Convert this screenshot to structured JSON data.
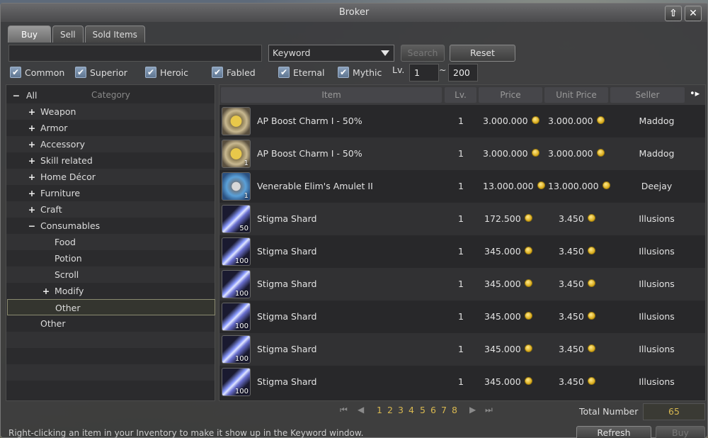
{
  "window": {
    "title": "Broker"
  },
  "title_buttons": {
    "restore": "⇧",
    "close": "✕"
  },
  "tabs": [
    {
      "label": "Buy"
    },
    {
      "label": "Sell"
    },
    {
      "label": "Sold Items"
    }
  ],
  "search": {
    "value": "",
    "mode": "Keyword",
    "search_label": "Search",
    "reset_label": "Reset"
  },
  "filters": [
    {
      "label": "Common",
      "checked": true
    },
    {
      "label": "Superior",
      "checked": true
    },
    {
      "label": "Heroic",
      "checked": true
    },
    {
      "label": "Fabled",
      "checked": true
    },
    {
      "label": "Eternal",
      "checked": true
    },
    {
      "label": "Mythic",
      "checked": true
    }
  ],
  "level": {
    "label": "Lv.",
    "min": "1",
    "sep": "~",
    "max": "200"
  },
  "category": {
    "header": "Category",
    "items": [
      {
        "toggle": "−",
        "label": "All"
      },
      {
        "toggle": "+",
        "label": "Weapon"
      },
      {
        "toggle": "+",
        "label": "Armor"
      },
      {
        "toggle": "+",
        "label": "Accessory"
      },
      {
        "toggle": "+",
        "label": "Skill related"
      },
      {
        "toggle": "+",
        "label": "Home Décor"
      },
      {
        "toggle": "+",
        "label": "Furniture"
      },
      {
        "toggle": "+",
        "label": "Craft"
      },
      {
        "toggle": "−",
        "label": "Consumables"
      },
      {
        "toggle": "",
        "label": "Food"
      },
      {
        "toggle": "",
        "label": "Potion"
      },
      {
        "toggle": "",
        "label": "Scroll"
      },
      {
        "toggle": "+",
        "label": "Modify"
      },
      {
        "toggle": "",
        "label": "Other"
      },
      {
        "toggle": "",
        "label": "Other"
      }
    ]
  },
  "columns": {
    "item": "Item",
    "lv": "Lv.",
    "price": "Price",
    "unit_price": "Unit Price",
    "seller": "Seller"
  },
  "rows": [
    {
      "icon": "charm-icon",
      "count": "",
      "name": "AP Boost Charm I - 50%",
      "lv": "1",
      "price": "3.000.000",
      "unit": "3.000.000",
      "seller": "Maddog"
    },
    {
      "icon": "charm-icon",
      "count": "1",
      "name": "AP Boost Charm I - 50%",
      "lv": "1",
      "price": "3.000.000",
      "unit": "3.000.000",
      "seller": "Maddog"
    },
    {
      "icon": "amulet-icon",
      "count": "1",
      "name": "Venerable Elim's Amulet II",
      "lv": "1",
      "price": "13.000.000",
      "unit": "13.000.000",
      "seller": "Deejay"
    },
    {
      "icon": "stigma-shard-icon",
      "count": "50",
      "name": "Stigma Shard",
      "lv": "1",
      "price": "172.500",
      "unit": "3.450",
      "seller": "Illusions"
    },
    {
      "icon": "stigma-shard-icon",
      "count": "100",
      "name": "Stigma Shard",
      "lv": "1",
      "price": "345.000",
      "unit": "3.450",
      "seller": "Illusions"
    },
    {
      "icon": "stigma-shard-icon",
      "count": "100",
      "name": "Stigma Shard",
      "lv": "1",
      "price": "345.000",
      "unit": "3.450",
      "seller": "Illusions"
    },
    {
      "icon": "stigma-shard-icon",
      "count": "100",
      "name": "Stigma Shard",
      "lv": "1",
      "price": "345.000",
      "unit": "3.450",
      "seller": "Illusions"
    },
    {
      "icon": "stigma-shard-icon",
      "count": "100",
      "name": "Stigma Shard",
      "lv": "1",
      "price": "345.000",
      "unit": "3.450",
      "seller": "Illusions"
    },
    {
      "icon": "stigma-shard-icon",
      "count": "100",
      "name": "Stigma Shard",
      "lv": "1",
      "price": "345.000",
      "unit": "3.450",
      "seller": "Illusions"
    }
  ],
  "pagination": {
    "pages": [
      "1",
      "2",
      "3",
      "4",
      "5",
      "6",
      "7",
      "8"
    ],
    "current": "1"
  },
  "total": {
    "label": "Total Number",
    "value": "65"
  },
  "footer": {
    "hint": "Right-clicking an item in your Inventory to make it show up in the Keyword window.",
    "refresh_label": "Refresh",
    "buy_label": "Buy"
  }
}
